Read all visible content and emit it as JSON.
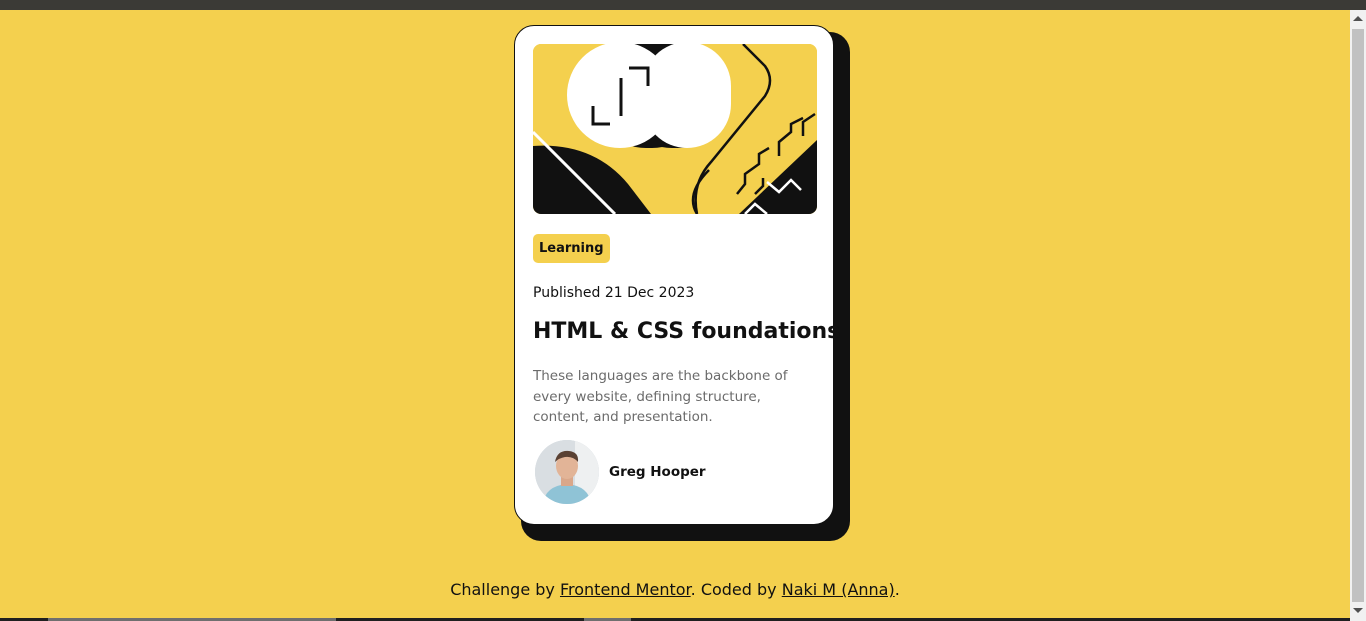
{
  "card": {
    "tag": "Learning",
    "published": "Published 21 Dec 2023",
    "title": "HTML & CSS foundations",
    "description": "These languages are the backbone of every website, defining structure, content, and presentation.",
    "author": {
      "name": "Greg Hooper"
    }
  },
  "footer": {
    "prefix": "Challenge by ",
    "mentor_link": "Frontend Mentor",
    "middle": ". Coded by ",
    "author_link": "Naki M (Anna)",
    "suffix": "."
  },
  "colors": {
    "background": "#f4d04e",
    "card": "#ffffff",
    "text": "#111111",
    "muted": "#6b6b6b"
  },
  "icons": [
    "illustration-article",
    "author-avatar"
  ]
}
